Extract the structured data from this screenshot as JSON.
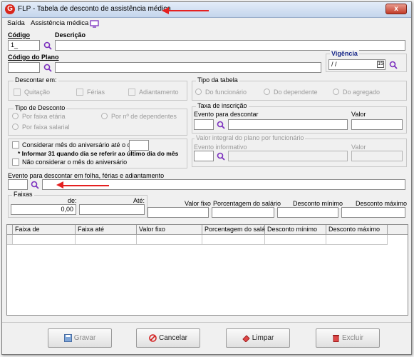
{
  "window": {
    "title": "FLP - Tabela de desconto de assistência médica",
    "close": "x"
  },
  "menu": {
    "saida": "Saída",
    "assistencia": "Assistência médica"
  },
  "codigo": {
    "label": "Código",
    "value": "1_"
  },
  "descricao": {
    "label": "Descrição",
    "value": ""
  },
  "codigo_plano": {
    "label": "Código do Plano",
    "value": ""
  },
  "vigencia": {
    "label": "Vigência",
    "value": " / /"
  },
  "descontar_em": {
    "title": "Descontar em:",
    "quitacao": "Quitação",
    "ferias": "Férias",
    "adiantamento": "Adiantamento"
  },
  "tipo_tabela": {
    "title": "Tipo da tabela",
    "funcionario": "Do funcionário",
    "dependente": "Do dependente",
    "agregado": "Do agregado"
  },
  "tipo_desconto": {
    "title": "Tipo de Desconto",
    "faixa_etaria": "Por faixa etária",
    "num_dependentes": "Por nº de dependentes",
    "faixa_salarial": "Por faixa salarial"
  },
  "taxa_inscricao": {
    "title": "Taxa de inscrição",
    "evento_label": "Evento para descontar",
    "valor_label": "Valor"
  },
  "aniversario": {
    "considerar": "Considerar mês do aniversário até o dia",
    "informar": "* Informar 31 quando dia se referir ao último dia do mês",
    "nao_considerar": "Não considerar o mês do aniversário"
  },
  "valor_integral": {
    "title": "Valor integral do plano por funcionário",
    "evento_label": "Evento informativo",
    "valor_label": "Valor"
  },
  "evento_folha": {
    "label": "Evento para descontar em folha, férias e adiantamento"
  },
  "faixas": {
    "title": "Faixas",
    "de_label": "de:",
    "de_value": "0,00",
    "ate_label": "Até:"
  },
  "valores": {
    "valor_fixo": "Valor fixo",
    "porcentagem": "Porcentagem do salário",
    "desconto_minimo": "Desconto mínimo",
    "desconto_maximo": "Desconto máximo"
  },
  "grid": {
    "columns": [
      "Faixa de",
      "Faixa até",
      "Valor fixo",
      "Porcentagem do salário",
      "Desconto mínimo",
      "Desconto máximo"
    ]
  },
  "buttons": {
    "gravar": "Gravar",
    "cancelar": "Cancelar",
    "limpar": "Limpar",
    "excluir": "Excluir"
  },
  "colors": {
    "accent": "#7b2fbe",
    "arrow": "#e52020"
  }
}
